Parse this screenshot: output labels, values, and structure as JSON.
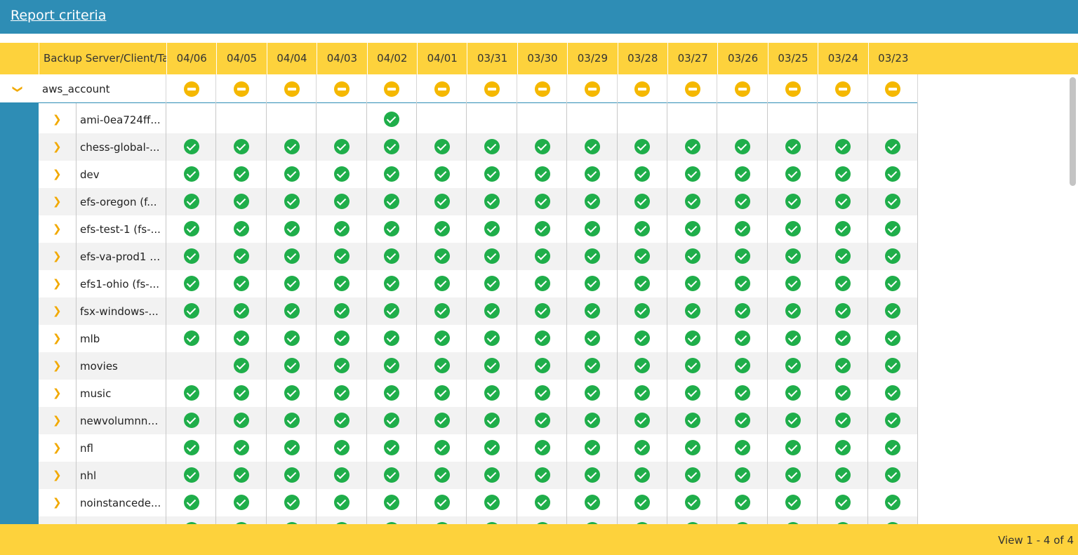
{
  "header": {
    "report_criteria_link": "Report criteria"
  },
  "table": {
    "name_column_label": "Backup Server/Client/Ta",
    "date_columns": [
      "04/06",
      "04/05",
      "04/04",
      "04/03",
      "04/02",
      "04/01",
      "03/31",
      "03/30",
      "03/29",
      "03/28",
      "03/27",
      "03/26",
      "03/25",
      "03/24",
      "03/23"
    ],
    "group": {
      "name": "aws_account",
      "statuses": [
        "partial",
        "partial",
        "partial",
        "partial",
        "partial",
        "partial",
        "partial",
        "partial",
        "partial",
        "partial",
        "partial",
        "partial",
        "partial",
        "partial",
        "partial"
      ]
    },
    "rows": [
      {
        "name": "ami-0ea724ff...",
        "statuses": [
          "",
          "",
          "",
          "",
          "success",
          "",
          "",
          "",
          "",
          "",
          "",
          "",
          "",
          "",
          ""
        ]
      },
      {
        "name": "chess-global-...",
        "statuses": [
          "success",
          "success",
          "success",
          "success",
          "success",
          "success",
          "success",
          "success",
          "success",
          "success",
          "success",
          "success",
          "success",
          "success",
          "success"
        ]
      },
      {
        "name": "dev",
        "statuses": [
          "success",
          "success",
          "success",
          "success",
          "success",
          "success",
          "success",
          "success",
          "success",
          "success",
          "success",
          "success",
          "success",
          "success",
          "success"
        ]
      },
      {
        "name": "efs-oregon (f...",
        "statuses": [
          "success",
          "success",
          "success",
          "success",
          "success",
          "success",
          "success",
          "success",
          "success",
          "success",
          "success",
          "success",
          "success",
          "success",
          "success"
        ]
      },
      {
        "name": "efs-test-1 (fs-...",
        "statuses": [
          "success",
          "success",
          "success",
          "success",
          "success",
          "success",
          "success",
          "success",
          "success",
          "success",
          "success",
          "success",
          "success",
          "success",
          "success"
        ]
      },
      {
        "name": "efs-va-prod1 (...",
        "statuses": [
          "success",
          "success",
          "success",
          "success",
          "success",
          "success",
          "success",
          "success",
          "success",
          "success",
          "success",
          "success",
          "success",
          "success",
          "success"
        ]
      },
      {
        "name": "efs1-ohio (fs-...",
        "statuses": [
          "success",
          "success",
          "success",
          "success",
          "success",
          "success",
          "success",
          "success",
          "success",
          "success",
          "success",
          "success",
          "success",
          "success",
          "success"
        ]
      },
      {
        "name": "fsx-windows-...",
        "statuses": [
          "success",
          "success",
          "success",
          "success",
          "success",
          "success",
          "success",
          "success",
          "success",
          "success",
          "success",
          "success",
          "success",
          "success",
          "success"
        ]
      },
      {
        "name": "mlb",
        "statuses": [
          "success",
          "success",
          "success",
          "success",
          "success",
          "success",
          "success",
          "success",
          "success",
          "success",
          "success",
          "success",
          "success",
          "success",
          "success"
        ]
      },
      {
        "name": "movies",
        "statuses": [
          "",
          "success",
          "success",
          "success",
          "success",
          "success",
          "success",
          "success",
          "success",
          "success",
          "success",
          "success",
          "success",
          "success",
          "success"
        ]
      },
      {
        "name": "music",
        "statuses": [
          "success",
          "success",
          "success",
          "success",
          "success",
          "success",
          "success",
          "success",
          "success",
          "success",
          "success",
          "success",
          "success",
          "success",
          "success"
        ]
      },
      {
        "name": "newvolumnno...",
        "statuses": [
          "success",
          "success",
          "success",
          "success",
          "success",
          "success",
          "success",
          "success",
          "success",
          "success",
          "success",
          "success",
          "success",
          "success",
          "success"
        ]
      },
      {
        "name": "nfl",
        "statuses": [
          "success",
          "success",
          "success",
          "success",
          "success",
          "success",
          "success",
          "success",
          "success",
          "success",
          "success",
          "success",
          "success",
          "success",
          "success"
        ]
      },
      {
        "name": "nhl",
        "statuses": [
          "success",
          "success",
          "success",
          "success",
          "success",
          "success",
          "success",
          "success",
          "success",
          "success",
          "success",
          "success",
          "success",
          "success",
          "success"
        ]
      },
      {
        "name": "noinstancede...",
        "statuses": [
          "success",
          "success",
          "success",
          "success",
          "success",
          "success",
          "success",
          "success",
          "success",
          "success",
          "success",
          "success",
          "success",
          "success",
          "success"
        ]
      },
      {
        "name": "",
        "statuses": [
          "success",
          "success",
          "success",
          "success",
          "success",
          "success",
          "success",
          "success",
          "success",
          "success",
          "success",
          "success",
          "success",
          "success",
          "success"
        ]
      }
    ]
  },
  "footer": {
    "pager_text": "View 1 - 4 of 4"
  },
  "colors": {
    "header_blue": "#2e8db5",
    "accent_yellow": "#fdd23c",
    "success_green": "#1fae4a",
    "partial_amber": "#f5b800"
  }
}
